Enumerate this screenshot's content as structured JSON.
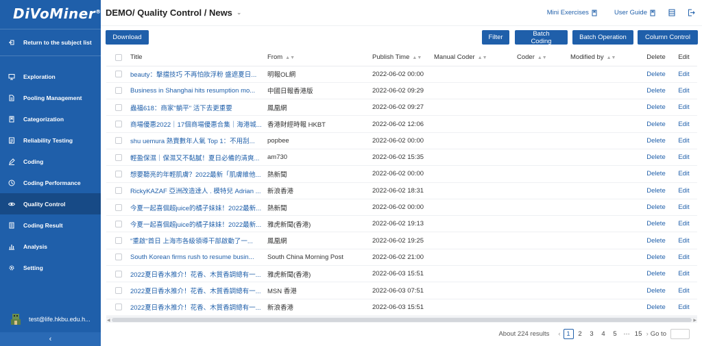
{
  "app": {
    "logo": "DiVoMiner",
    "logo_mark": "®"
  },
  "sidebar": {
    "back_label": "Return to the subject list",
    "items": [
      {
        "label": "Exploration",
        "icon": "monitor-icon"
      },
      {
        "label": "Pooling Management",
        "icon": "document-icon"
      },
      {
        "label": "Categorization",
        "icon": "folder-icon"
      },
      {
        "label": "Reliability Testing",
        "icon": "checklist-icon"
      },
      {
        "label": "Coding",
        "icon": "pen-icon"
      },
      {
        "label": "Coding Performance",
        "icon": "clock-icon"
      },
      {
        "label": "Quality Control",
        "icon": "eye-icon"
      },
      {
        "label": "Coding Result",
        "icon": "report-icon"
      },
      {
        "label": "Analysis",
        "icon": "bar-chart-icon"
      },
      {
        "label": "Setting",
        "icon": "gear-icon"
      }
    ],
    "active_item": "Quality Control",
    "user": "test@life.hkbu.edu.h..."
  },
  "header": {
    "title": "DEMO/ Quality Control / News",
    "links": [
      "Mini Exercises",
      "User Guide"
    ]
  },
  "toolbar": {
    "download": "Download",
    "filter": "Filter",
    "batch_coding": "Batch Coding",
    "batch_operation": "Batch Operation",
    "column_control": "Column Control"
  },
  "table": {
    "columns": [
      "Title",
      "From",
      "Publish Time",
      "Manual Coder",
      "Coder",
      "Modified by",
      "Delete",
      "Edit"
    ],
    "action_delete": "Delete",
    "action_edit": "Edit",
    "rows": [
      {
        "title": "beauty：擊擋技巧 不再怕妝浮粉 盛遮夏日...",
        "from": "明報OL網",
        "time": "2022-06-02 00:00"
      },
      {
        "title": "Business in Shanghai hits resumption mo...",
        "from": "中國日報香港版",
        "time": "2022-06-02 09:29"
      },
      {
        "title": "蟲福618：商家\"躺平\" 活下去更重要",
        "from": "鳳凰網",
        "time": "2022-06-02 09:27"
      },
      {
        "title": "商場優惠2022｜17個商場優惠合集｜海港城...",
        "from": "香港財經時報 HKBT",
        "time": "2022-06-02 12:06"
      },
      {
        "title": "shu uemura 熱賣數年人氣 Top 1：不用刮...",
        "from": "popbee",
        "time": "2022-06-02 00:00"
      },
      {
        "title": "輕盈保濕｜保濕又不黏膩！夏日必備的清爽...",
        "from": "am730",
        "time": "2022-06-02 15:35"
      },
      {
        "title": "想要聽亮的年輕肌膚？2022最新「肌膚維他...",
        "from": "熱新聞",
        "time": "2022-06-02 00:00"
      },
      {
        "title": "RickyKAZAF 亞洲改造達人 . 模特兒 Adrian ...",
        "from": "新浪香港",
        "time": "2022-06-02 18:31"
      },
      {
        "title": "今夏一起喜個超juice的橘子妹妹！2022最新...",
        "from": "熱新聞",
        "time": "2022-06-02 00:00"
      },
      {
        "title": "今夏一起喜個超juice的橘子妹妹！2022最新...",
        "from": "雅虎新聞(香港)",
        "time": "2022-06-02 19:13"
      },
      {
        "title": "\"重啟\"首日 上海市各級領導干部啟動了一...",
        "from": "鳳凰網",
        "time": "2022-06-02 19:25"
      },
      {
        "title": "South Korean firms rush to resume busin...",
        "from": "South China Morning Post",
        "time": "2022-06-02 21:00"
      },
      {
        "title": "2022夏日香水推介！花香、木質香調總有一...",
        "from": "雅虎新聞(香港)",
        "time": "2022-06-03 15:51"
      },
      {
        "title": "2022夏日香水推介！花香、木質香調總有一...",
        "from": "MSN 香港",
        "time": "2022-06-03 07:51"
      },
      {
        "title": "2022夏日香水推介！花香、木質香調總有一...",
        "from": "新浪香港",
        "time": "2022-06-03 15:51"
      }
    ]
  },
  "pagination": {
    "total": "About 224 results",
    "pages": [
      "1",
      "2",
      "3",
      "4",
      "5"
    ],
    "current": "1",
    "ellipsis": "···",
    "last": "15",
    "goto_label": "Go to"
  },
  "colors": {
    "primary": "#1f5faa",
    "sidebar": "#1f5faa",
    "sidebar_active": "#174a86"
  }
}
